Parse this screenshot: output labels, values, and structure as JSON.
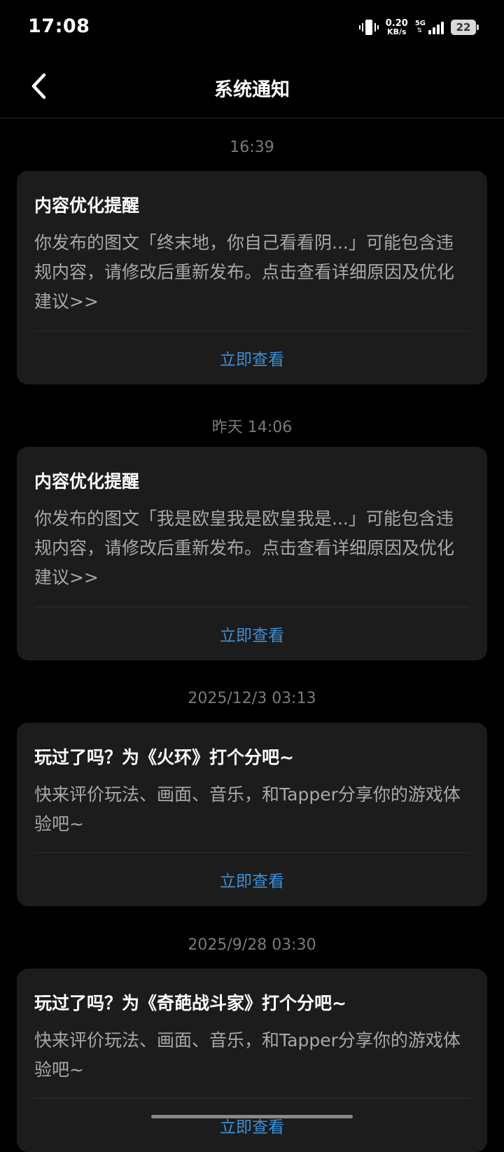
{
  "status_bar": {
    "time": "17:08",
    "net_speed_value": "0.20",
    "net_speed_unit": "KB/s",
    "network_type": "5G",
    "battery": "22"
  },
  "header": {
    "title": "系统通知"
  },
  "notifications": [
    {
      "timestamp": "16:39",
      "title": "内容优化提醒",
      "body": "你发布的图文「终末地，你自己看看阴...」可能包含违规内容，请修改后重新发布。点击查看详细原因及优化建议>>",
      "action": "立即查看"
    },
    {
      "timestamp": "昨天  14:06",
      "title": "内容优化提醒",
      "body": "你发布的图文「我是欧皇我是欧皇我是...」可能包含违规内容，请修改后重新发布。点击查看详细原因及优化建议>>",
      "action": "立即查看"
    },
    {
      "timestamp": "2025/12/3  03:13",
      "title": "玩过了吗？为《火环》打个分吧~",
      "body": "快来评价玩法、画面、音乐，和Tapper分享你的游戏体验吧~",
      "action": "立即查看"
    },
    {
      "timestamp": "2025/9/28  03:30",
      "title": "玩过了吗？为《奇葩战斗家》打个分吧~",
      "body": "快来评价玩法、画面、音乐，和Tapper分享你的游戏体验吧~",
      "action": "立即查看"
    }
  ],
  "colors": {
    "background": "#000000",
    "card": "#1c1c1c",
    "action_link": "#3d8fd6",
    "timestamp": "#7a7a7a"
  }
}
